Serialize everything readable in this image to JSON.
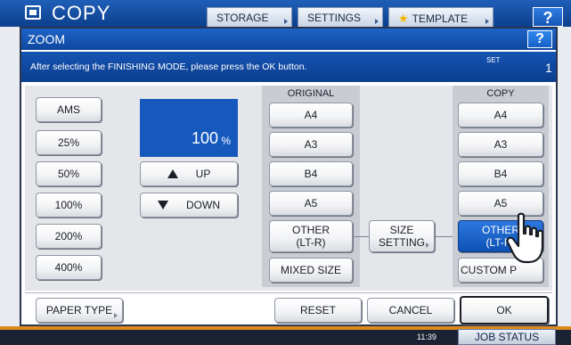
{
  "app": {
    "title": "COPY",
    "tabs": [
      "STORAGE",
      "SETTINGS",
      "TEMPLATE"
    ],
    "help": "?",
    "job_status": "JOB STATUS",
    "clock": "11:39"
  },
  "dialog": {
    "title": "ZOOM",
    "help": "?",
    "message": "After selecting the FINISHING MODE, please press the OK button.",
    "set_label": "SET",
    "set_count": "1"
  },
  "zoom": {
    "presets": [
      "AMS",
      "25%",
      "50%",
      "100%",
      "200%",
      "400%"
    ],
    "value": "100",
    "unit": "%",
    "up_label": "UP",
    "down_label": "DOWN"
  },
  "original": {
    "header": "ORIGINAL",
    "sizes": [
      "A4",
      "A3",
      "B4",
      "A5"
    ],
    "other_line1": "OTHER",
    "other_line2": "(LT-R)",
    "mixed_size": "MIXED SIZE"
  },
  "size_setting": {
    "line1": "SIZE",
    "line2": "SETTING"
  },
  "copy": {
    "header": "COPY",
    "sizes": [
      "A4",
      "A3",
      "B4",
      "A5"
    ],
    "other_line1": "OTHER",
    "other_line2": "(LT-R)",
    "custom": "CUSTOM P"
  },
  "footer": {
    "paper_type": "PAPER TYPE",
    "reset": "RESET",
    "cancel": "CANCEL",
    "ok": "OK"
  },
  "colors": {
    "titlebar": "#1d63c6",
    "selected": "#1659bd",
    "panel": "#e4e6ea"
  },
  "icons": [
    "copy-app-icon",
    "star-icon",
    "up-triangle-icon",
    "down-triangle-icon",
    "pointing-hand-icon"
  ]
}
